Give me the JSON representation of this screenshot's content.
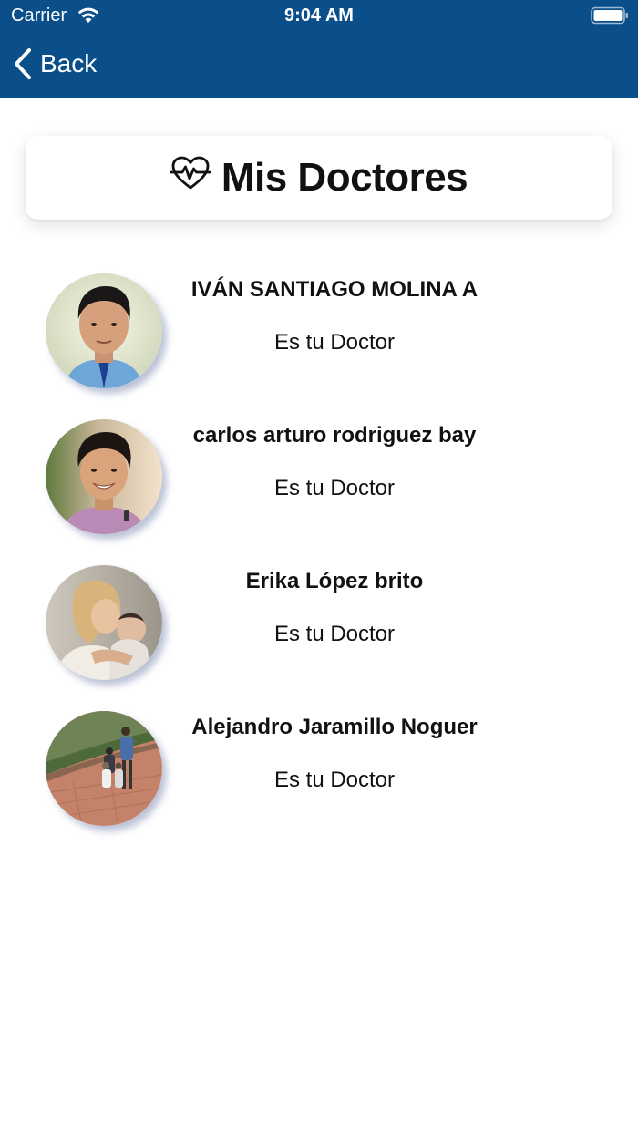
{
  "status_bar": {
    "carrier": "Carrier",
    "time": "9:04 AM"
  },
  "nav": {
    "back_label": "Back",
    "background_color": "#0a4f8a"
  },
  "header": {
    "title": "Mis Doctores",
    "icon": "heart-pulse-icon"
  },
  "doctors": [
    {
      "name": "IVÁN SANTIAGO MOLINA A",
      "role": "Es tu Doctor"
    },
    {
      "name": "carlos arturo rodriguez bay",
      "role": "Es tu Doctor"
    },
    {
      "name": "Erika López brito",
      "role": "Es tu Doctor"
    },
    {
      "name": "Alejandro Jaramillo Noguer",
      "role": "Es tu Doctor"
    }
  ]
}
